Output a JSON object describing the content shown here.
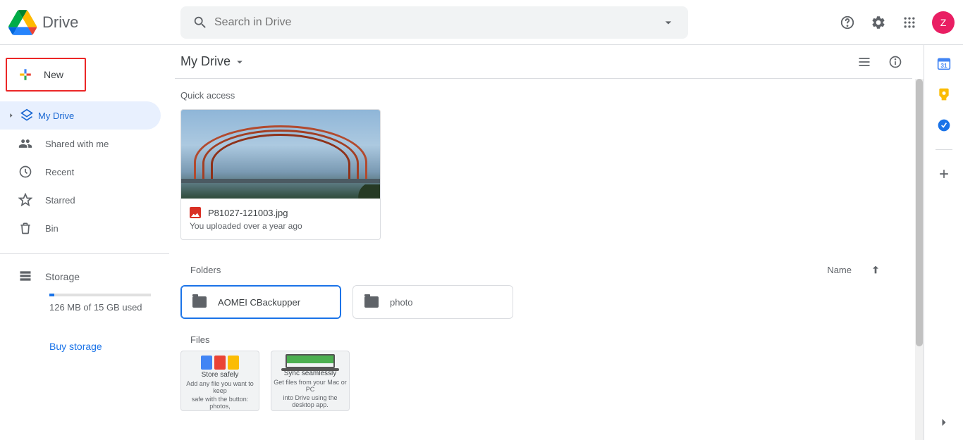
{
  "header": {
    "appName": "Drive",
    "searchPlaceholder": "Search in Drive",
    "avatarLetter": "Z"
  },
  "sidebar": {
    "newLabel": "New",
    "items": [
      {
        "label": "My Drive"
      },
      {
        "label": "Shared with me"
      },
      {
        "label": "Recent"
      },
      {
        "label": "Starred"
      },
      {
        "label": "Bin"
      }
    ],
    "storage": {
      "label": "Storage",
      "usageText": "126 MB of 15 GB used",
      "buyLabel": "Buy storage"
    }
  },
  "content": {
    "breadcrumb": "My Drive",
    "quickAccessTitle": "Quick access",
    "quickAccess": [
      {
        "filename": "P81027-121003.jpg",
        "subtitle": "You uploaded over a year ago"
      }
    ],
    "foldersTitle": "Folders",
    "sortLabel": "Name",
    "folders": [
      {
        "name": "AOMEI CBackupper",
        "selected": true
      },
      {
        "name": "photo",
        "selected": false
      }
    ],
    "filesTitle": "Files",
    "promoCards": [
      {
        "title": "Store safely",
        "sub1": "Add any file you want to keep",
        "sub2": "safe with the button: photos,"
      },
      {
        "title": "Sync seamlessly",
        "sub1": "Get files from your Mac or PC",
        "sub2": "into Drive using the desktop app."
      }
    ]
  }
}
